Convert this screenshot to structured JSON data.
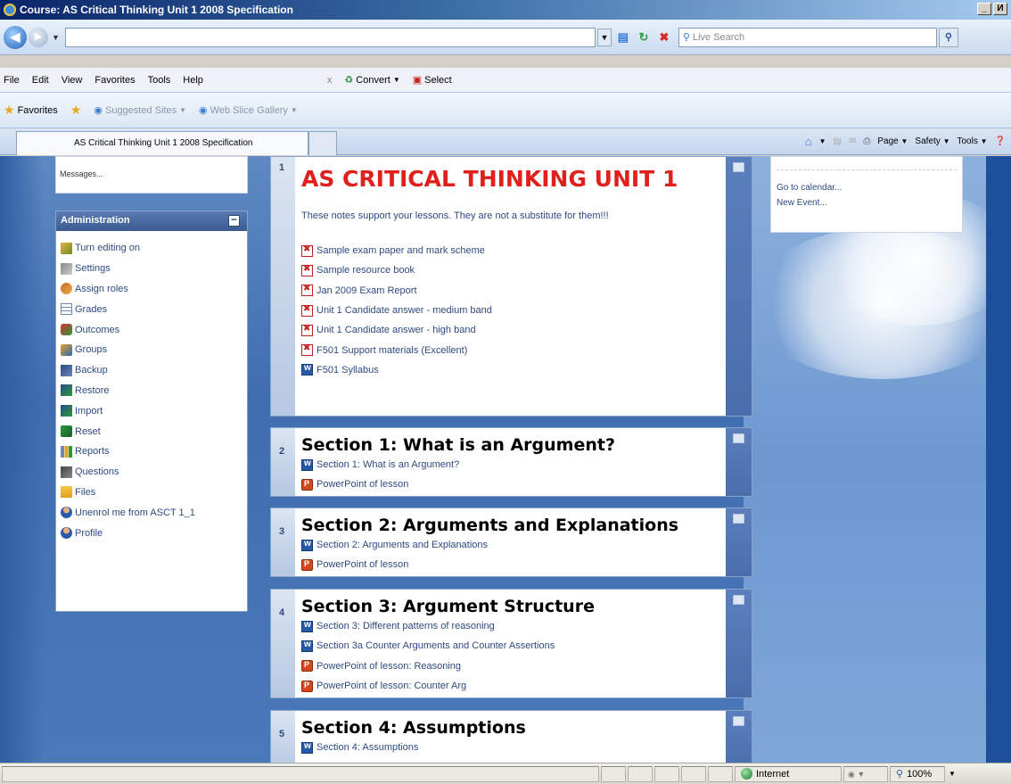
{
  "window": {
    "title": "Course: AS Critical Thinking Unit 1 2008 Specification",
    "min": "_",
    "max": "И"
  },
  "addressbar": {
    "search_placeholder": "Live Search"
  },
  "menu": {
    "items": [
      "File",
      "Edit",
      "View",
      "Favorites",
      "Tools",
      "Help"
    ],
    "close": "x",
    "convert": "Convert",
    "select": "Select"
  },
  "favorites": {
    "label": "Favorites",
    "suggested": "Suggested Sites",
    "webslice": "Web Slice Gallery"
  },
  "tab": {
    "label": "AS Critical Thinking Unit 1 2008 Specification"
  },
  "commandbar": {
    "page": "Page",
    "safety": "Safety",
    "tools": "Tools"
  },
  "messages_block": {
    "text": "Messages..."
  },
  "admin": {
    "title": "Administration",
    "items": [
      "Turn editing on",
      "Settings",
      "Assign roles",
      "Grades",
      "Outcomes",
      "Groups",
      "Backup",
      "Restore",
      "Import",
      "Reset",
      "Reports",
      "Questions",
      "Files",
      "Unenrol me from ASCT 1_1",
      "Profile"
    ]
  },
  "sections": [
    {
      "number": "1",
      "title": "AS CRITICAL THINKING UNIT 1",
      "note": "These notes support your lessons.  They are not a substitute for them!!!",
      "resources": [
        "Sample exam paper and mark scheme",
        "Sample resource book",
        "Jan 2009 Exam Report",
        "Unit 1 Candidate answer - medium band",
        "Unit 1 Candidate answer - high band",
        "F501 Support materials (Excellent)",
        "F501 Syllabus"
      ]
    },
    {
      "number": "2",
      "title": "Section 1: What is an Argument?",
      "resources": [
        "Section 1: What is an Argument?",
        "PowerPoint of lesson"
      ]
    },
    {
      "number": "3",
      "title": "Section 2: Arguments and Explanations",
      "resources": [
        "Section 2: Arguments and Explanations",
        "PowerPoint of lesson"
      ]
    },
    {
      "number": "4",
      "title": "Section 3: Argument Structure",
      "resources": [
        "Section 3: Different patterns of reasoning",
        "Section 3a Counter Arguments and Counter Assertions",
        "PowerPoint of lesson: Reasoning",
        "PowerPoint of lesson: Counter Arg"
      ]
    },
    {
      "number": "5",
      "title": "Section 4: Assumptions",
      "resources": [
        "Section 4: Assumptions"
      ]
    }
  ],
  "calendar": {
    "goto": "Go to calendar...",
    "new_event": "New Event..."
  },
  "status": {
    "zone": "Internet",
    "zoom": "100%"
  }
}
